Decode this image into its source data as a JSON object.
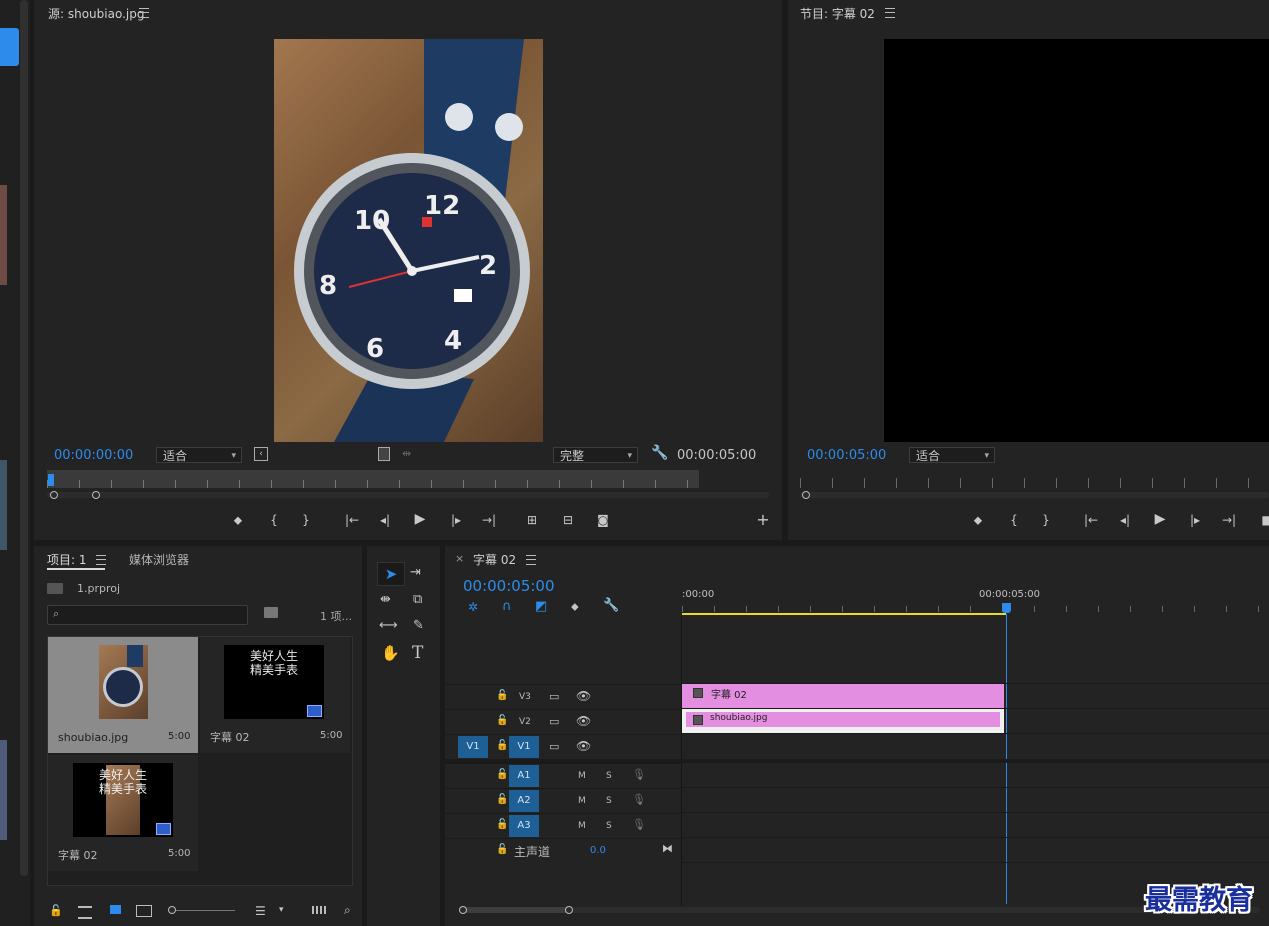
{
  "source_monitor": {
    "title": "源: shoubiao.jpg",
    "timecode_in": "00:00:00:00",
    "zoom": "适合",
    "quality": "完整",
    "duration": "00:00:05:00"
  },
  "program_monitor": {
    "title": "节目: 字幕 02",
    "timecode": "00:00:05:00",
    "zoom": "适合"
  },
  "project_panel": {
    "tab_project": "项目: 1",
    "tab_media": "媒体浏览器",
    "project_file": "1.prproj",
    "item_count": "1 项...",
    "search_placeholder": "",
    "items": [
      {
        "name": "shoubiao.jpg",
        "duration": "5:00"
      },
      {
        "name": "字幕 02",
        "duration": "5:00",
        "thumb_text_1": "美好人生",
        "thumb_text_2": "精美手表"
      },
      {
        "name": "字幕 02",
        "duration": "5:00",
        "thumb_text_1": "美好人生",
        "thumb_text_2": "精美手表"
      }
    ]
  },
  "timeline": {
    "tab": "字幕 02",
    "timecode": "00:00:05:00",
    "ruler_start": ":00:00",
    "ruler_mark": "00:00:05:00",
    "tracks": {
      "v3": "V3",
      "v2": "V2",
      "v1": "V1",
      "v1_src": "V1",
      "a1": "A1",
      "a2": "A2",
      "a3": "A3",
      "mute": "M",
      "solo": "S",
      "master": "主声道",
      "master_value": "0.0"
    },
    "clips": {
      "v3_clip": "字幕 02",
      "v2_clip": "shoubiao.jpg"
    }
  },
  "watermark": "最需教育",
  "colors": {
    "accent": "#2d8ceb",
    "clip_pink": "#e38ee0",
    "track_blue": "#1e5f96"
  }
}
